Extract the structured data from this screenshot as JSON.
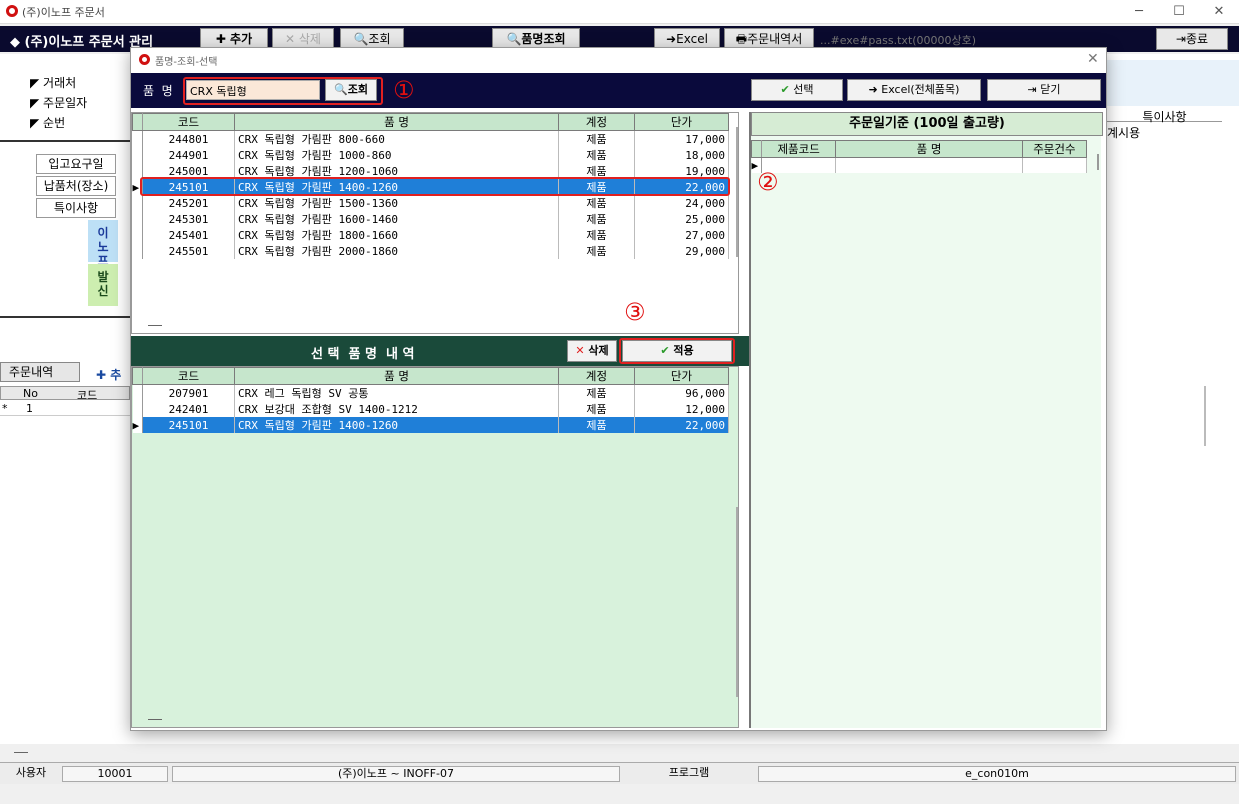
{
  "app": {
    "title": "(주)이노프 주문서",
    "module_title": "◆ (주)이노프 주문서 관리"
  },
  "window_controls": {
    "minimize": "─",
    "maximize": "☐",
    "close": "✕"
  },
  "toolbar": {
    "add": "✚ 추가",
    "delete": "✕ 삭제",
    "search": "조회",
    "item_search": "품명조회",
    "excel": "Excel",
    "print": "주문내역서",
    "path": "...#exe#pass.txt(00000상호)",
    "exit": "종료"
  },
  "form": {
    "client_label": "거래처",
    "order_date_label": "주문일자",
    "seq_label": "순번",
    "receive_date_label": "입고요구일",
    "delivery_label": "납품처(장소)",
    "remarks_label": "특이사항",
    "tag_inop": "이\n노\n프",
    "tag_send": "발\n신",
    "right_remarks_header": "특이사항",
    "right_remarks_value": "계시용"
  },
  "order_list": {
    "tab": "주문내역",
    "add": "✚ 추",
    "headers": [
      "No",
      "코드"
    ],
    "rows": [
      {
        "no": "1"
      }
    ]
  },
  "dialog": {
    "title": "품명-조회-선택",
    "item_name_label": "품  명",
    "search_value": "CRX 독립형",
    "search_button": "조회",
    "select_button": "선택",
    "excel_button": "Excel(전체품목)",
    "close_button": "닫기",
    "markers": [
      "①",
      "②",
      "③"
    ],
    "top_grid": {
      "headers": [
        "코드",
        "품 명",
        "계정",
        "단가"
      ],
      "rows": [
        {
          "code": "244801",
          "name": "CRX 독립형 가림판 800-660",
          "type": "제품",
          "price": "17,000"
        },
        {
          "code": "244901",
          "name": "CRX 독립형 가림판 1000-860",
          "type": "제품",
          "price": "18,000"
        },
        {
          "code": "245001",
          "name": "CRX 독립형 가림판 1200-1060",
          "type": "제품",
          "price": "19,000"
        },
        {
          "code": "245101",
          "name": "CRX 독립형 가림판 1400-1260",
          "type": "제품",
          "price": "22,000"
        },
        {
          "code": "245201",
          "name": "CRX 독립형 가림판 1500-1360",
          "type": "제품",
          "price": "24,000"
        },
        {
          "code": "245301",
          "name": "CRX 독립형 가림판 1600-1460",
          "type": "제품",
          "price": "25,000"
        },
        {
          "code": "245401",
          "name": "CRX 독립형 가림판 1800-1660",
          "type": "제품",
          "price": "27,000"
        },
        {
          "code": "245501",
          "name": "CRX 독립형 가림판 2000-1860",
          "type": "제품",
          "price": "29,000"
        }
      ]
    },
    "right_panel": {
      "title": "주문일기준 (100일 출고량)",
      "headers": [
        "제품코드",
        "품 명",
        "주문건수"
      ]
    },
    "selected_section": {
      "title": "선 택  품 명  내 역",
      "delete_button": "삭제",
      "apply_button": "적용"
    },
    "bottom_grid": {
      "headers": [
        "코드",
        "품 명",
        "계정",
        "단가"
      ],
      "rows": [
        {
          "code": "207901",
          "name": "CRX 레그 독립형 SV 공통",
          "type": "제품",
          "price": "96,000"
        },
        {
          "code": "242401",
          "name": "CRX 보강대 조합형 SV 1400-1212",
          "type": "제품",
          "price": "12,000"
        },
        {
          "code": "245101",
          "name": "CRX 독립형 가림판 1400-1260",
          "type": "제품",
          "price": "22,000"
        }
      ]
    }
  },
  "statusbar": {
    "user_label": "사용자",
    "user_id": "10001",
    "company": "(주)이노프 ~ INOFF-07",
    "program_label": "프로그램",
    "program_id": "e_con010m"
  },
  "colors": {
    "dark_navy": "#0a0a3c",
    "grid_header": "#c6e6cc",
    "selected_row": "#1f7fd8",
    "panel_green": "#d8f2dc",
    "highlight_red": "#e02020"
  }
}
